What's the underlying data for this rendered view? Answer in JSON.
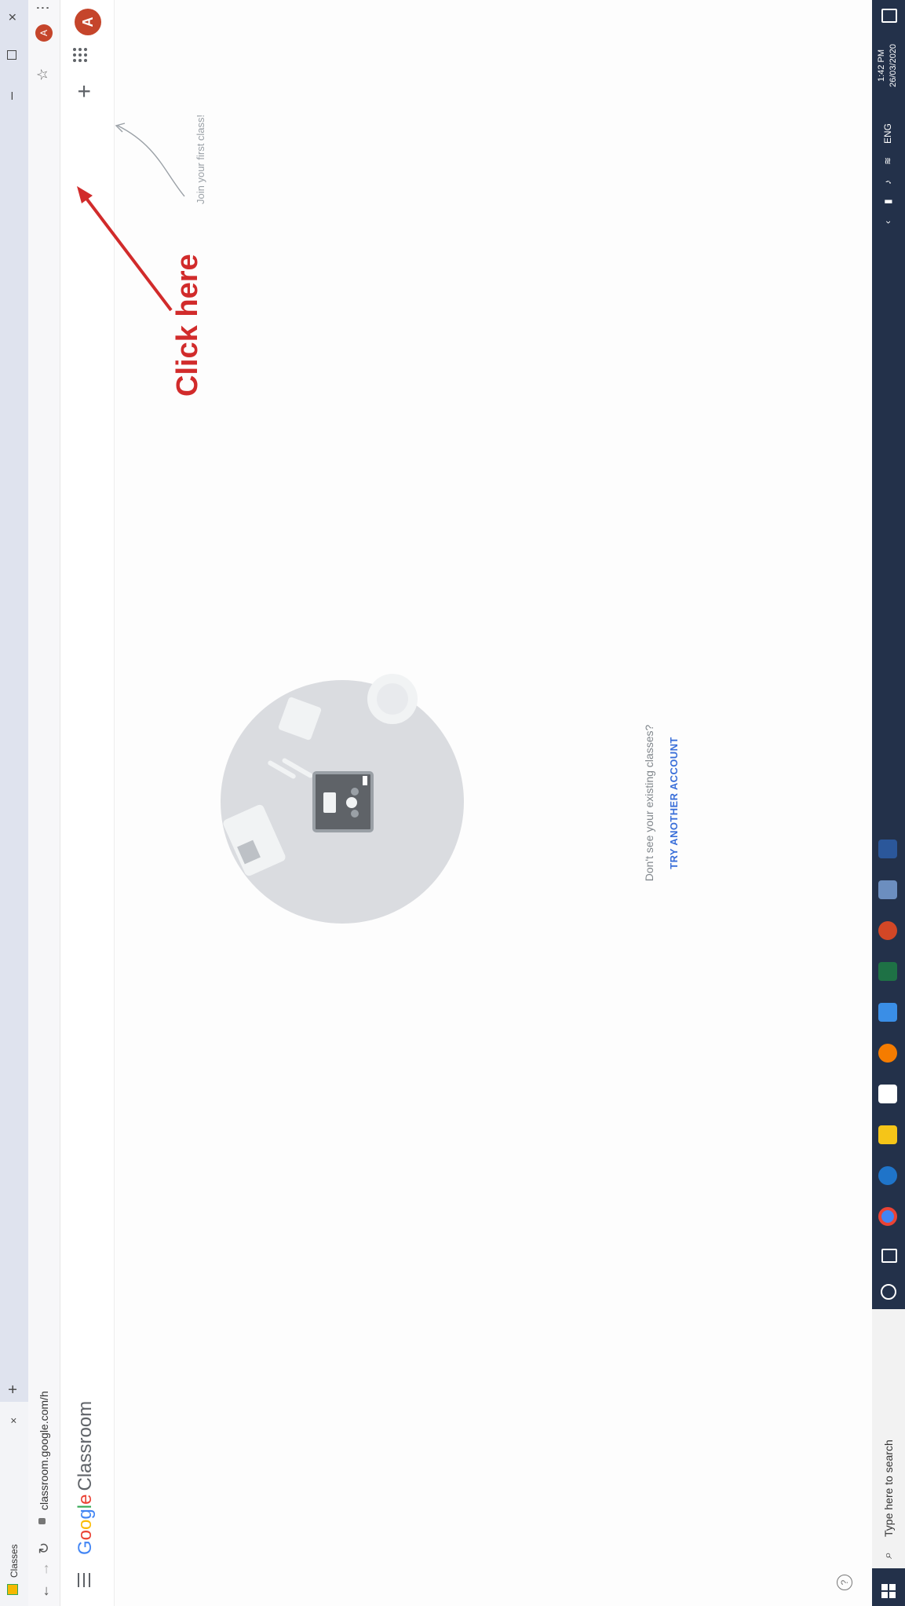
{
  "browser": {
    "tab_title": "Classes",
    "tab_close": "×",
    "new_tab": "+",
    "url": "classroom.google.com/h",
    "profile_initial": "A",
    "menu": "⋮",
    "minimize": "–",
    "close": "×"
  },
  "header": {
    "logo_letters": [
      "G",
      "o",
      "o",
      "g",
      "l",
      "e"
    ],
    "logo_product": "Classroom",
    "add_icon": "+",
    "avatar_initial": "A"
  },
  "hint": {
    "join_text": "Join your first class!"
  },
  "annotation": {
    "text": "Click here",
    "color": "#d12b2b"
  },
  "empty_state": {
    "question": "Don't see your existing classes?",
    "try_button": "TRY ANOTHER ACCOUNT"
  },
  "help": {
    "icon": "?"
  },
  "taskbar": {
    "search_placeholder": "Type here to search",
    "language": "ENG",
    "time": "1:42 PM",
    "date": "26/03/2020",
    "pinned_apps": [
      "chrome-icon",
      "edge-icon",
      "file-explorer-icon",
      "store-icon",
      "firefox-icon",
      "photos-icon",
      "excel-icon",
      "powerpoint-icon",
      "paint-icon",
      "word-icon"
    ]
  },
  "colors": {
    "accent_blue": "#3a6fd9",
    "avatar": "#c5452b",
    "taskbar": "#23314a"
  }
}
